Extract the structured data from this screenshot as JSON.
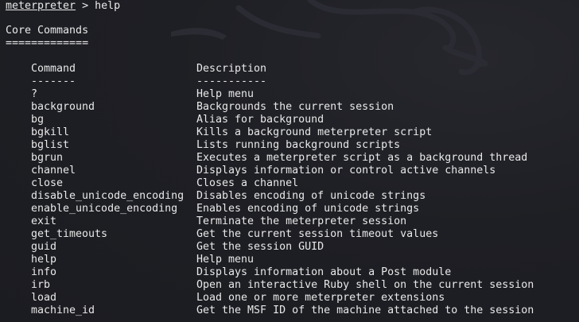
{
  "prompt": {
    "name": "meterpreter",
    "symbol": ">",
    "command": "help"
  },
  "section": {
    "title": "Core Commands",
    "underline": "============="
  },
  "table": {
    "headers": {
      "command": "Command",
      "description": "Description"
    },
    "separators": {
      "command": "-------",
      "description": "-----------"
    },
    "rows": [
      {
        "command": "?",
        "description": "Help menu"
      },
      {
        "command": "background",
        "description": "Backgrounds the current session"
      },
      {
        "command": "bg",
        "description": "Alias for background"
      },
      {
        "command": "bgkill",
        "description": "Kills a background meterpreter script"
      },
      {
        "command": "bglist",
        "description": "Lists running background scripts"
      },
      {
        "command": "bgrun",
        "description": "Executes a meterpreter script as a background thread"
      },
      {
        "command": "channel",
        "description": "Displays information or control active channels"
      },
      {
        "command": "close",
        "description": "Closes a channel"
      },
      {
        "command": "disable_unicode_encoding",
        "description": "Disables encoding of unicode strings"
      },
      {
        "command": "enable_unicode_encoding",
        "description": "Enables encoding of unicode strings"
      },
      {
        "command": "exit",
        "description": "Terminate the meterpreter session"
      },
      {
        "command": "get_timeouts",
        "description": "Get the current session timeout values"
      },
      {
        "command": "guid",
        "description": "Get the session GUID"
      },
      {
        "command": "help",
        "description": "Help menu"
      },
      {
        "command": "info",
        "description": "Displays information about a Post module"
      },
      {
        "command": "irb",
        "description": "Open an interactive Ruby shell on the current session"
      },
      {
        "command": "load",
        "description": "Load one or more meterpreter extensions"
      },
      {
        "command": "machine_id",
        "description": "Get the MSF ID of the machine attached to the session"
      }
    ]
  },
  "colors": {
    "background": "#1c1d22",
    "text": "#e9e9e9",
    "watermark": "#2a2b31"
  },
  "icons": {
    "watermark": "kali-dragon-icon"
  }
}
